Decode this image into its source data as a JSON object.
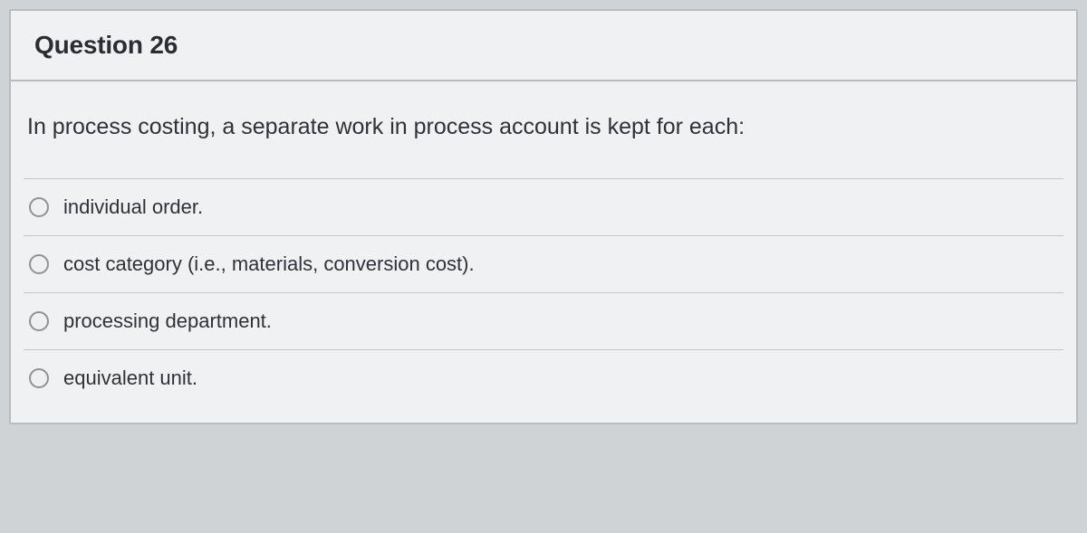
{
  "question": {
    "title": "Question 26",
    "prompt": "In process costing, a separate work in process account is kept for each:",
    "options": [
      {
        "label": "individual order."
      },
      {
        "label": "cost category (i.e., materials, conversion cost)."
      },
      {
        "label": "processing department."
      },
      {
        "label": "equivalent unit."
      }
    ]
  }
}
